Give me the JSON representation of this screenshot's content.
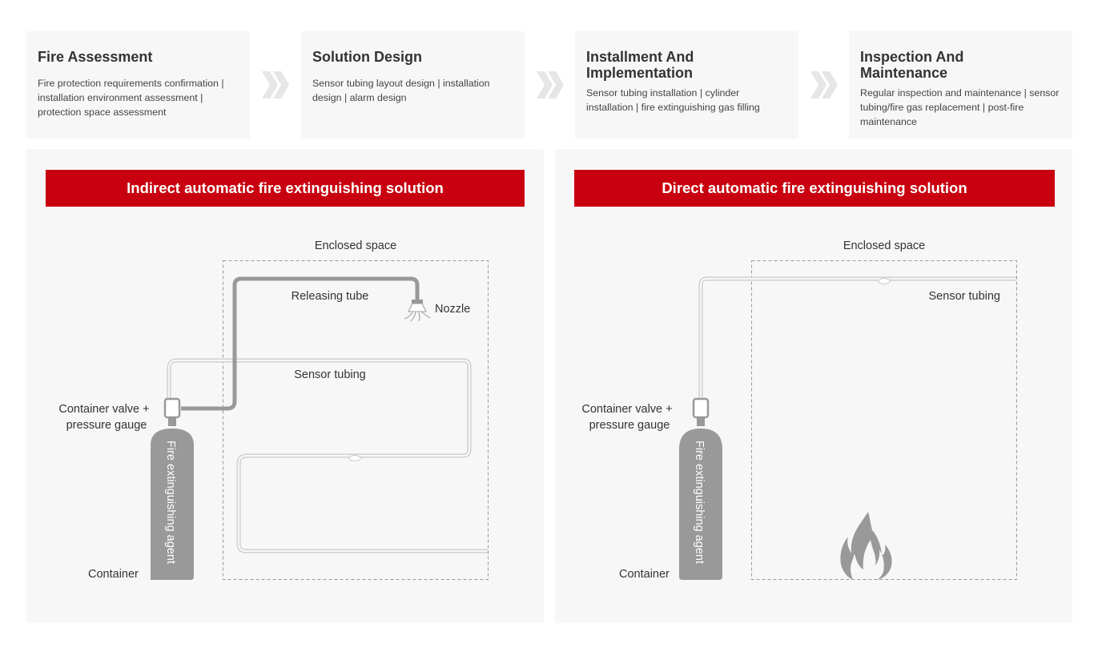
{
  "process_steps": [
    {
      "title": "Fire Assessment",
      "description": "Fire protection requirements confirmation | installation environment assessment | protection space assessment"
    },
    {
      "title": "Solution Design",
      "description": "Sensor tubing layout design | installation design | alarm design"
    },
    {
      "title": "Installment And Implementation",
      "description": "Sensor tubing installation | cylinder installation | fire extinguishing gas filling"
    },
    {
      "title": "Inspection And Maintenance",
      "description": "Regular inspection and maintenance | sensor tubing/fire gas replacement | post-fire maintenance"
    }
  ],
  "step_arrow_icon": "double-chevron-right-icon",
  "colors": {
    "accent_red": "#c8000f",
    "panel_bg": "#f7f7f7",
    "equipment_gray": "#999999",
    "tubing_gray": "#c8c8c8"
  },
  "indirect_solution": {
    "title": "Indirect automatic fire extinguishing solution",
    "labels": {
      "enclosed_space": "Enclosed space",
      "releasing_tube": "Releasing tube",
      "nozzle": "Nozzle",
      "sensor_tubing": "Sensor tubing",
      "valve_line1": "Container valve +",
      "valve_line2": "pressure gauge",
      "container": "Container",
      "agent": "Fire extinguishing agent"
    }
  },
  "direct_solution": {
    "title": "Direct automatic fire extinguishing solution",
    "labels": {
      "enclosed_space": "Enclosed space",
      "sensor_tubing": "Sensor tubing",
      "valve_line1": "Container valve +",
      "valve_line2": "pressure gauge",
      "container": "Container",
      "agent": "Fire extinguishing agent"
    },
    "fire_icon": "flame-icon"
  }
}
